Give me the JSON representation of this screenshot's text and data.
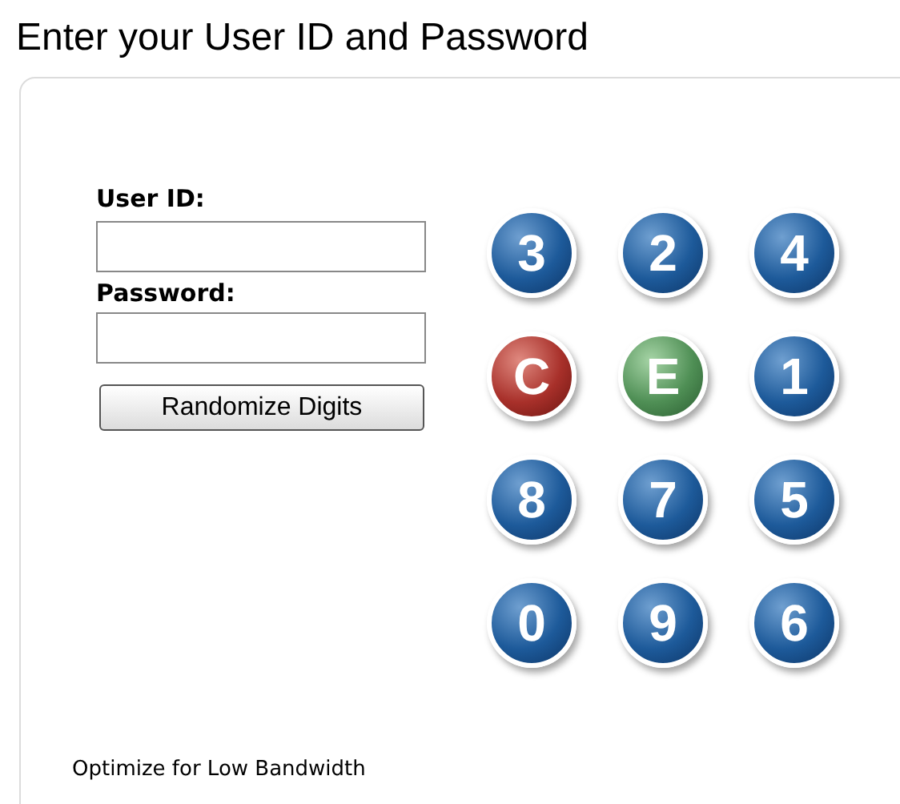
{
  "title": "Enter your User ID and Password",
  "form": {
    "user_id_label": "User ID:",
    "password_label": "Password:",
    "randomize_button": "Randomize Digits"
  },
  "keypad": [
    {
      "label": "3",
      "kind": "digit"
    },
    {
      "label": "2",
      "kind": "digit"
    },
    {
      "label": "4",
      "kind": "digit"
    },
    {
      "label": "C",
      "kind": "clear"
    },
    {
      "label": "E",
      "kind": "enter"
    },
    {
      "label": "1",
      "kind": "digit"
    },
    {
      "label": "8",
      "kind": "digit"
    },
    {
      "label": "7",
      "kind": "digit"
    },
    {
      "label": "5",
      "kind": "digit"
    },
    {
      "label": "0",
      "kind": "digit"
    },
    {
      "label": "9",
      "kind": "digit"
    },
    {
      "label": "6",
      "kind": "digit"
    }
  ],
  "footer_link": "Optimize for Low Bandwidth"
}
